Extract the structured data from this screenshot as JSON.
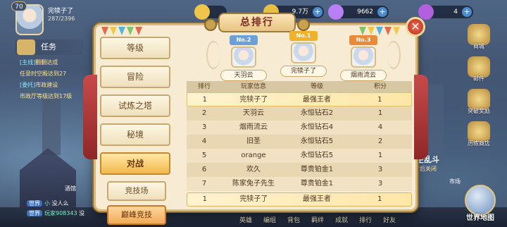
{
  "player": {
    "level": "70",
    "name": "完犊子了",
    "exp": "287/2396"
  },
  "tasks": {
    "title": "任务",
    "lines": [
      {
        "tag": "[主线]",
        "text": "翻翻达成"
      },
      {
        "tag": "",
        "text": "任意时空殿达到27"
      },
      {
        "tag": "[委托]",
        "text": "市政建设"
      },
      {
        "tag": "",
        "text": "市政厅等级达到17级"
      }
    ]
  },
  "currencies": [
    {
      "value": "",
      "color": "#f0c64a"
    },
    {
      "value": "9.7万",
      "color": "#e7c043"
    },
    {
      "value": "9662",
      "color": "#b97ff5"
    },
    {
      "value": "4",
      "color": "#b260e0"
    }
  ],
  "right_nav": [
    {
      "label": "商城",
      "icon": "shop-icon"
    },
    {
      "label": "邮件",
      "icon": "mail-icon"
    },
    {
      "label": "突破奖励",
      "icon": "breakthrough-icon"
    },
    {
      "label": "历练商店",
      "icon": "training-shop-icon"
    }
  ],
  "event": {
    "title": "时空乱斗",
    "sub": "小时后关闭"
  },
  "world_map_label": "世界地图",
  "tavern_label": "酒馆",
  "market_label": "市场",
  "chat": [
    {
      "channel": "世界",
      "name": "小",
      "text": "没人么"
    },
    {
      "channel": "世界",
      "name": "玩家908343",
      "text": "没"
    }
  ],
  "bottom_bar": [
    "英雄",
    "编组",
    "背包",
    "羁绊",
    "成就",
    "排行",
    "好友"
  ],
  "dialog": {
    "title": "总排行",
    "close": "✕",
    "menu": [
      {
        "label": "等级",
        "active": false
      },
      {
        "label": "冒险",
        "active": false
      },
      {
        "label": "试炼之塔",
        "active": false
      },
      {
        "label": "秘境",
        "active": false
      },
      {
        "label": "对战",
        "active": true
      }
    ],
    "sub_menu": [
      {
        "label": "竞技场",
        "active": false
      },
      {
        "label": "巅峰竞技",
        "active": true
      }
    ],
    "podium": [
      {
        "rank": "No.2",
        "name": "天羽云"
      },
      {
        "rank": "No.1",
        "name": "完犊子了"
      },
      {
        "rank": "No.3",
        "name": "烟雨流云"
      }
    ],
    "table": {
      "headers": [
        "排行",
        "玩家信息",
        "等级",
        "积分"
      ],
      "rows": [
        [
          "1",
          "完犊子了",
          "最强王者",
          "1"
        ],
        [
          "2",
          "天羽云",
          "永恒钻石2",
          "1"
        ],
        [
          "3",
          "烟雨流云",
          "永恒钻石4",
          "4"
        ],
        [
          "4",
          "旧圣",
          "永恒钻石5",
          "2"
        ],
        [
          "5",
          "orange",
          "永恒钻石5",
          "1"
        ],
        [
          "6",
          "欢久",
          "尊贵铂金1",
          "3"
        ],
        [
          "7",
          "陈家兔子先生",
          "尊贵铂金1",
          "3"
        ]
      ],
      "my_row": [
        "1",
        "完犊子了",
        "最强王者",
        "1"
      ]
    }
  }
}
